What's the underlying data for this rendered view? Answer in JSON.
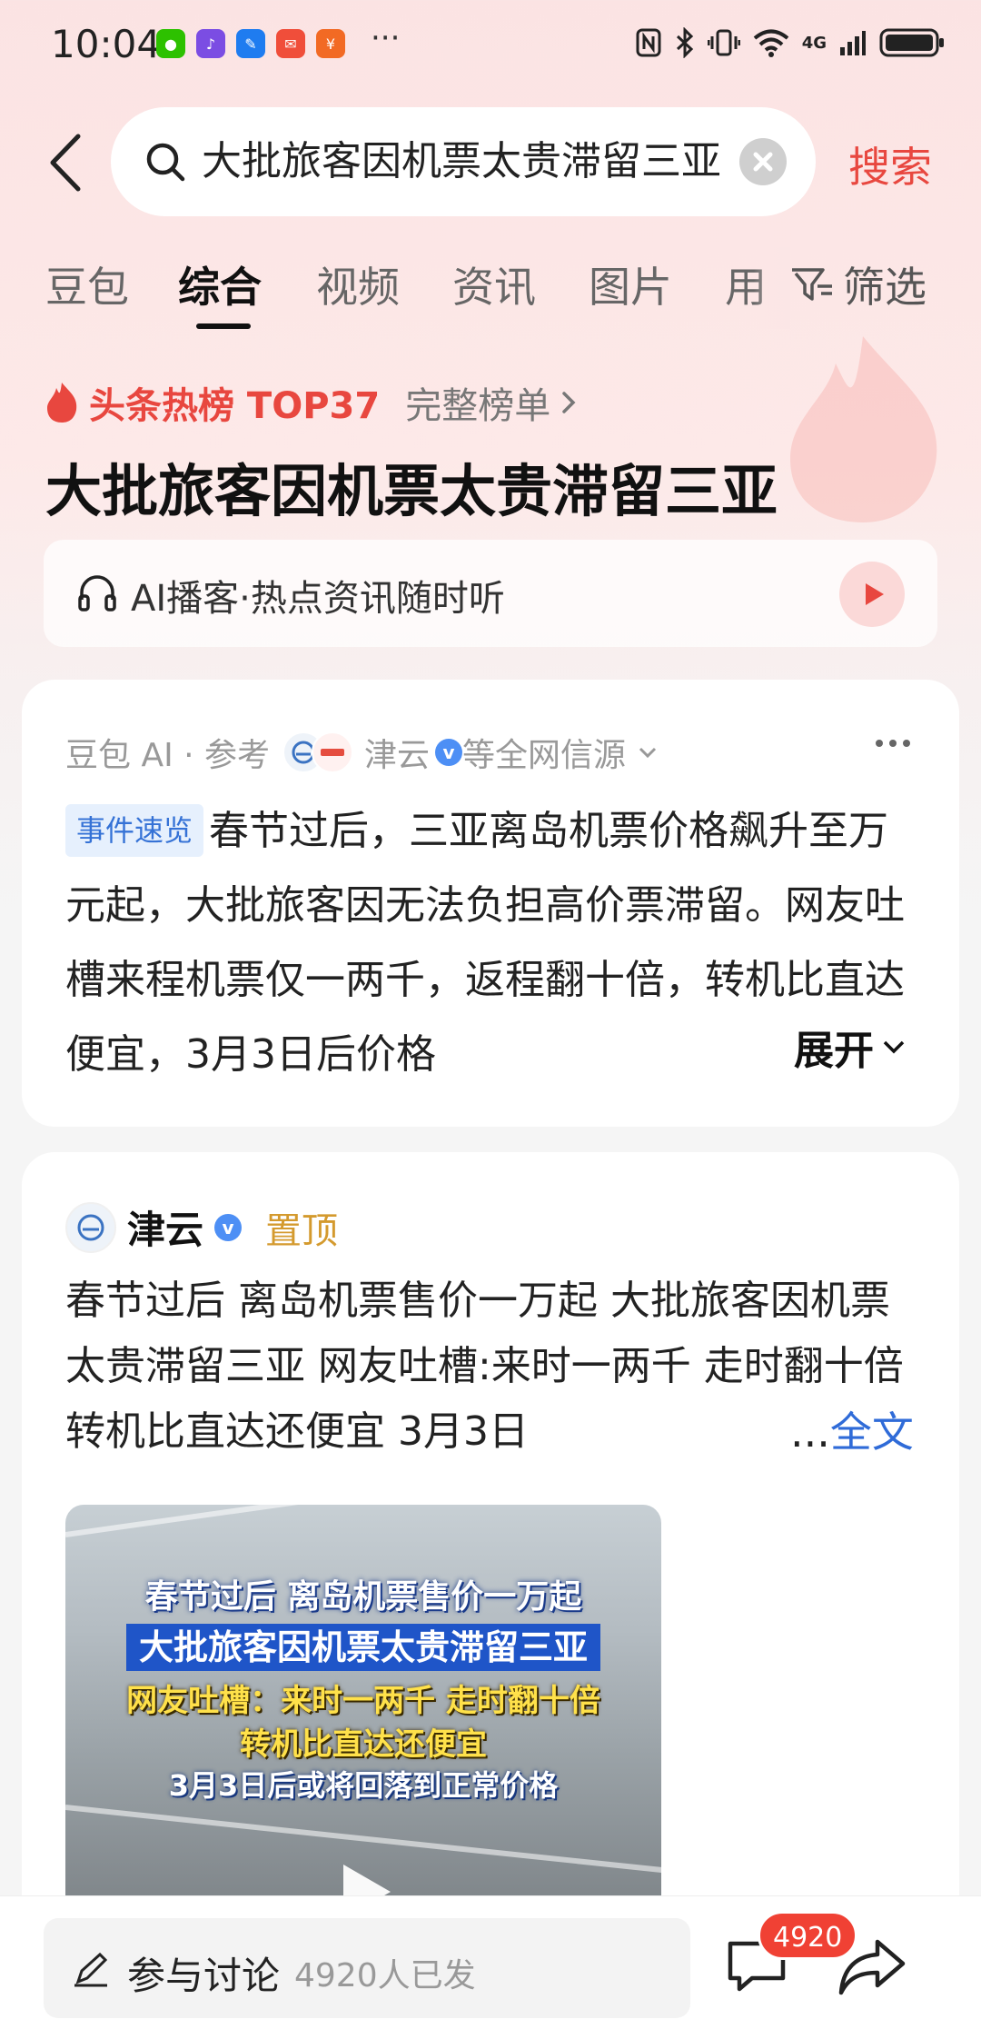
{
  "status_bar": {
    "time": "10:04",
    "app_icons": [
      "wechat-icon",
      "music-icon",
      "notes-icon",
      "mail-icon",
      "bank-icon"
    ],
    "more": "···",
    "network": "4G"
  },
  "search": {
    "query": "大批旅客因机票太贵滞留三亚",
    "submit_label": "搜索"
  },
  "tabs": {
    "items": [
      "豆包",
      "综合",
      "视频",
      "资讯",
      "图片",
      "用"
    ],
    "active": "综合",
    "filter_label": "筛选"
  },
  "hot": {
    "rank_label": "头条热榜 TOP37",
    "full_list_label": "完整榜单",
    "title": "大批旅客因机票太贵滞留三亚"
  },
  "podcast": {
    "label": "AI播客·热点资讯随时听"
  },
  "ai_card": {
    "source_prefix": "豆包 AI · 参考",
    "source_name": "津云",
    "source_suffix": "等全网信源",
    "event_tag": "事件速览",
    "summary": "春节过后，三亚离岛机票价格飙升至万元起，大批旅客因无法负担高价票滞留。网友吐槽来程机票仅一两千，返程翻十倍，转机比直达便宜，3月3日后价格",
    "expand_label": "展开"
  },
  "post": {
    "author": "津云",
    "pinned_label": "置顶",
    "text": "春节过后 离岛机票售价一万起 大批旅客因机票太贵滞留三亚 网友吐槽:来时一两千 走时翻十倍 转机比直达还便宜 3月3日",
    "ellipsis": "...",
    "fulltext_label": "全文",
    "video_captions": [
      "春节过后 离岛机票售价一万起",
      "大批旅客因机票太贵滞留三亚",
      "网友吐槽：来时一两千 走时翻十倍",
      "转机比直达还便宜",
      "3月3日后或将回落到正常价格"
    ]
  },
  "bottom": {
    "discuss_label": "参与讨论",
    "discuss_count": "4920人已发",
    "comment_badge": "4920"
  },
  "colors": {
    "accent_red": "#e8473f",
    "link_blue": "#2f6bd8",
    "pinned_gold": "#d49a2e",
    "tag_blue": "#3572d6"
  }
}
